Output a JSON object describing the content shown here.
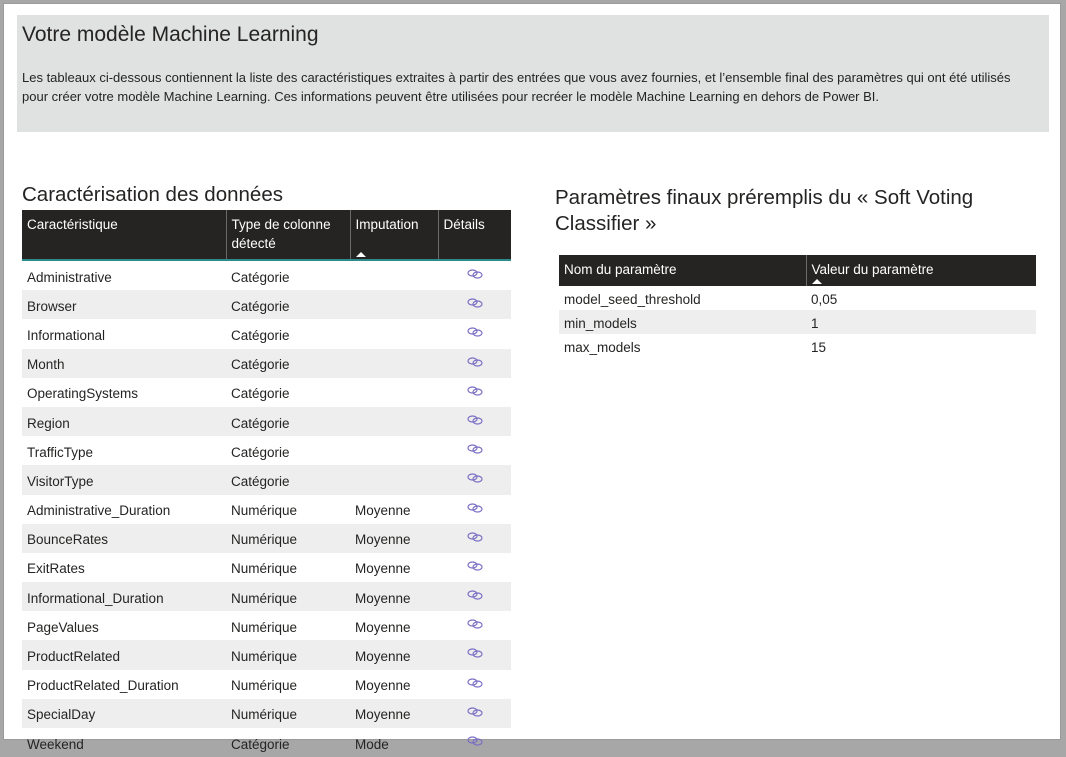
{
  "header": {
    "title": "Votre modèle Machine Learning",
    "description": "Les tableaux ci-dessous contiennent la liste des caractéristiques extraites à partir des entrées que vous avez fournies, et l’ensemble final des paramètres qui ont été utilisés pour créer votre modèle Machine Learning. Ces informations peuvent être utilisées pour recréer le modèle Machine Learning en dehors de Power BI."
  },
  "features_section": {
    "title": "Caractérisation des données",
    "columns": {
      "feature": "Caractéristique",
      "type": "Type de colonne détecté",
      "imputation": "Imputation",
      "details": "Détails"
    },
    "sorted_column": "imputation",
    "rows": [
      {
        "feature": "Administrative",
        "type": "Catégorie",
        "imputation": "",
        "details_icon": "link-icon"
      },
      {
        "feature": "Browser",
        "type": "Catégorie",
        "imputation": "",
        "details_icon": "link-icon"
      },
      {
        "feature": "Informational",
        "type": "Catégorie",
        "imputation": "",
        "details_icon": "link-icon"
      },
      {
        "feature": "Month",
        "type": "Catégorie",
        "imputation": "",
        "details_icon": "link-icon"
      },
      {
        "feature": "OperatingSystems",
        "type": "Catégorie",
        "imputation": "",
        "details_icon": "link-icon"
      },
      {
        "feature": "Region",
        "type": "Catégorie",
        "imputation": "",
        "details_icon": "link-icon"
      },
      {
        "feature": "TrafficType",
        "type": "Catégorie",
        "imputation": "",
        "details_icon": "link-icon"
      },
      {
        "feature": "VisitorType",
        "type": "Catégorie",
        "imputation": "",
        "details_icon": "link-icon"
      },
      {
        "feature": "Administrative_Duration",
        "type": "Numérique",
        "imputation": "Moyenne",
        "details_icon": "link-icon"
      },
      {
        "feature": "BounceRates",
        "type": "Numérique",
        "imputation": "Moyenne",
        "details_icon": "link-icon"
      },
      {
        "feature": "ExitRates",
        "type": "Numérique",
        "imputation": "Moyenne",
        "details_icon": "link-icon"
      },
      {
        "feature": "Informational_Duration",
        "type": "Numérique",
        "imputation": "Moyenne",
        "details_icon": "link-icon"
      },
      {
        "feature": "PageValues",
        "type": "Numérique",
        "imputation": "Moyenne",
        "details_icon": "link-icon"
      },
      {
        "feature": "ProductRelated",
        "type": "Numérique",
        "imputation": "Moyenne",
        "details_icon": "link-icon"
      },
      {
        "feature": "ProductRelated_Duration",
        "type": "Numérique",
        "imputation": "Moyenne",
        "details_icon": "link-icon"
      },
      {
        "feature": "SpecialDay",
        "type": "Numérique",
        "imputation": "Moyenne",
        "details_icon": "link-icon"
      },
      {
        "feature": "Weekend",
        "type": "Catégorie",
        "imputation": "Mode",
        "details_icon": "link-icon"
      }
    ]
  },
  "params_section": {
    "title": "Paramètres finaux préremplis du « Soft Voting Classifier »",
    "columns": {
      "name": "Nom du paramètre",
      "value": "Valeur du paramètre"
    },
    "sorted_column": "value",
    "rows": [
      {
        "name": "model_seed_threshold",
        "value": "0,05"
      },
      {
        "name": "min_models",
        "value": "1"
      },
      {
        "name": "max_models",
        "value": "15"
      }
    ]
  },
  "colors": {
    "header_panel": "#dfe2e1",
    "table_header": "#252423",
    "table_header_accent": "#2e8b8b",
    "row_alt": "#eeeeee",
    "link_icon": "#7a6fc4"
  }
}
